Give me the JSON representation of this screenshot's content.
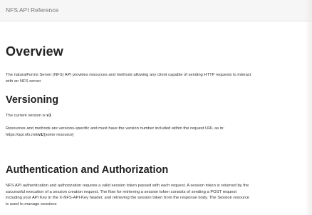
{
  "header": {
    "title": "NFS API Reference"
  },
  "overview": {
    "heading": "Overview",
    "body_line1": "The naturalForms Server (NFS) API provides resources and methods allowing any client capable of sending HTTP requests to interact",
    "body_line2": "with an NFS server."
  },
  "versioning": {
    "heading": "Versioning",
    "current_prefix": "The current version is ",
    "current_version": "v1",
    "rules_line1": "Resources and methods are versions-specific and must have the version number included within the request URL as in:",
    "url_prefix": "https://api.nfs.net/",
    "url_version": "v1",
    "url_suffix": "/[some resource]"
  },
  "auth": {
    "heading": "Authentication and Authorization",
    "body_line1": "NFS API authentication and authorization requires a valid session token passed with each request. A session token is returned by the",
    "body_line2": "successful execution of a session creation request. The flow for retrieving a session token consists of sending a POST request",
    "body_line3": "including your API Key in the X-NFS-API-Key header, and retrieving the session token from the response body. The Session resource",
    "body_line4": "is used to manage sessions"
  }
}
